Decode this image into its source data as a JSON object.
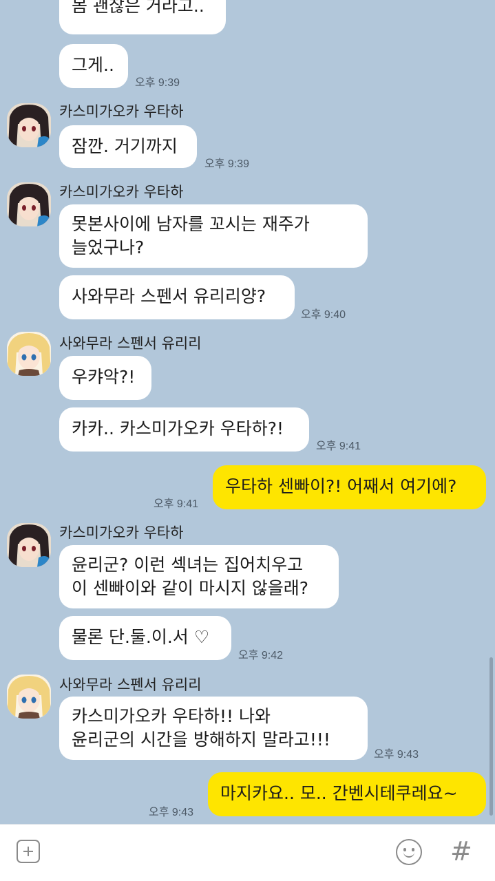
{
  "messages": [
    {
      "text": "몸 괜찮은 거라고..",
      "time": ""
    },
    {
      "text": "그게..",
      "time": "오후 9:39"
    },
    {
      "sender": "카스미가오카 우타하",
      "text": "잠깐. 거기까지",
      "time": "오후 9:39"
    },
    {
      "sender": "카스미가오카 우타하",
      "line1": "못본사이에 남자를 꼬시는 재주가",
      "line2": "늘었구나?"
    },
    {
      "text": "사와무라 스펜서 유리리양?",
      "time": "오후 9:40"
    },
    {
      "sender": "사와무라 스펜서 유리리",
      "text": "우캬악?!"
    },
    {
      "text": "카카.. 카스미가오카 우타하?!",
      "time": "오후 9:41"
    },
    {
      "text": "우타하 센빠이?! 어째서 여기에?",
      "time": "오후 9:41",
      "mine": true
    },
    {
      "sender": "카스미가오카 우타하",
      "line1": "윤리군? 이런 섹녀는 집어치우고",
      "line2": "이 센빠이와 같이 마시지 않을래?"
    },
    {
      "text": "물론 단.둘.이.서 ♡",
      "time": "오후 9:42"
    },
    {
      "sender": "사와무라 스펜서 유리리",
      "line1": "카스미가오카 우타하!! 나와",
      "line2": "윤리군의 시간을 방해하지 말라고!!!",
      "time": "오후 9:43"
    },
    {
      "text": "마지카요.. 모.. 간벤시테쿠레요~",
      "time": "오후 9:43",
      "mine": true
    }
  ],
  "input_bar": {
    "add_icon": "plus-square-icon",
    "emoji_icon": "smiley-icon",
    "hashtag_icon": "#"
  },
  "colors": {
    "background": "#b2c7da",
    "incoming_bubble": "#ffffff",
    "outgoing_bubble": "#fee500"
  }
}
